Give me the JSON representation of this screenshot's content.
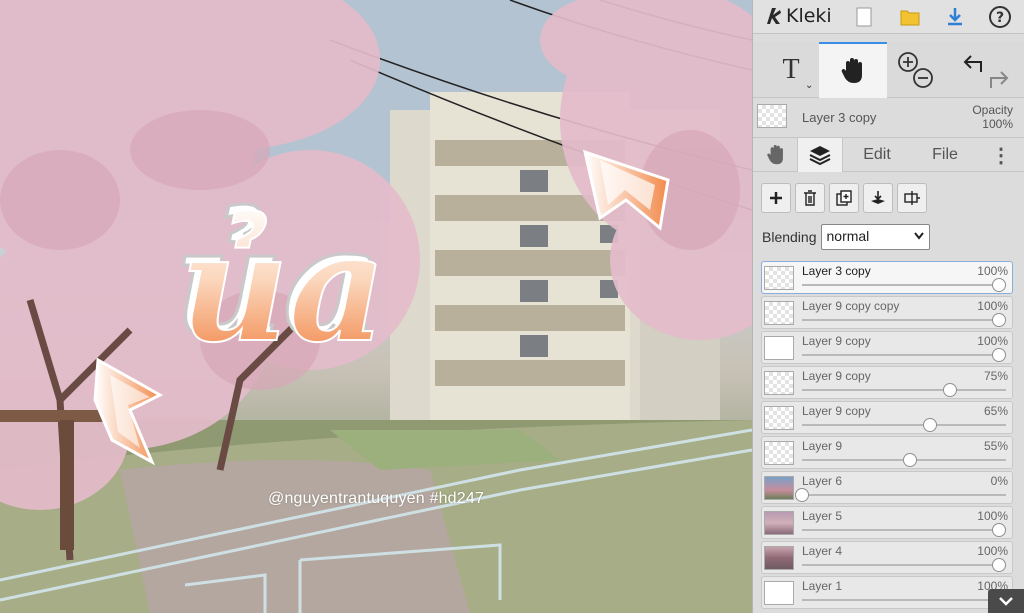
{
  "canvas": {
    "overlay_text": "ủa",
    "watermark": "@nguyentrantuquyen  #hd247"
  },
  "app": {
    "name": "Kleki"
  },
  "toolbar": {
    "text_tool_icon": "T",
    "icons": [
      "new-file-icon",
      "open-folder-icon",
      "download-icon",
      "help-icon",
      "text-tool-icon",
      "hand-tool-icon",
      "zoom-in-icon",
      "zoom-out-icon",
      "undo-icon",
      "redo-icon"
    ]
  },
  "current_layer": {
    "name": "Layer 3 copy",
    "opacity_label": "Opacity",
    "opacity_value": "100%"
  },
  "tabs": {
    "edit": "Edit",
    "file": "File"
  },
  "blending": {
    "label": "Blending",
    "value": "normal"
  },
  "layers": [
    {
      "name": "Layer 3 copy",
      "opacity": "100%",
      "level": 1.0,
      "selected": true
    },
    {
      "name": "Layer 9 copy copy",
      "opacity": "100%",
      "level": 1.0
    },
    {
      "name": "Layer 9 copy",
      "opacity": "100%",
      "level": 1.0
    },
    {
      "name": "Layer 9 copy",
      "opacity": "75%",
      "level": 0.75
    },
    {
      "name": "Layer 9 copy",
      "opacity": "65%",
      "level": 0.65
    },
    {
      "name": "Layer 9",
      "opacity": "55%",
      "level": 0.55
    },
    {
      "name": "Layer 6",
      "opacity": "0%",
      "level": 0.0
    },
    {
      "name": "Layer 5",
      "opacity": "100%",
      "level": 1.0
    },
    {
      "name": "Layer 4",
      "opacity": "100%",
      "level": 1.0
    },
    {
      "name": "Layer 1",
      "opacity": "100%",
      "level": 1.0
    }
  ],
  "colors": {
    "accent": "#3a8ee6",
    "text_orange": "#f28a4c"
  }
}
